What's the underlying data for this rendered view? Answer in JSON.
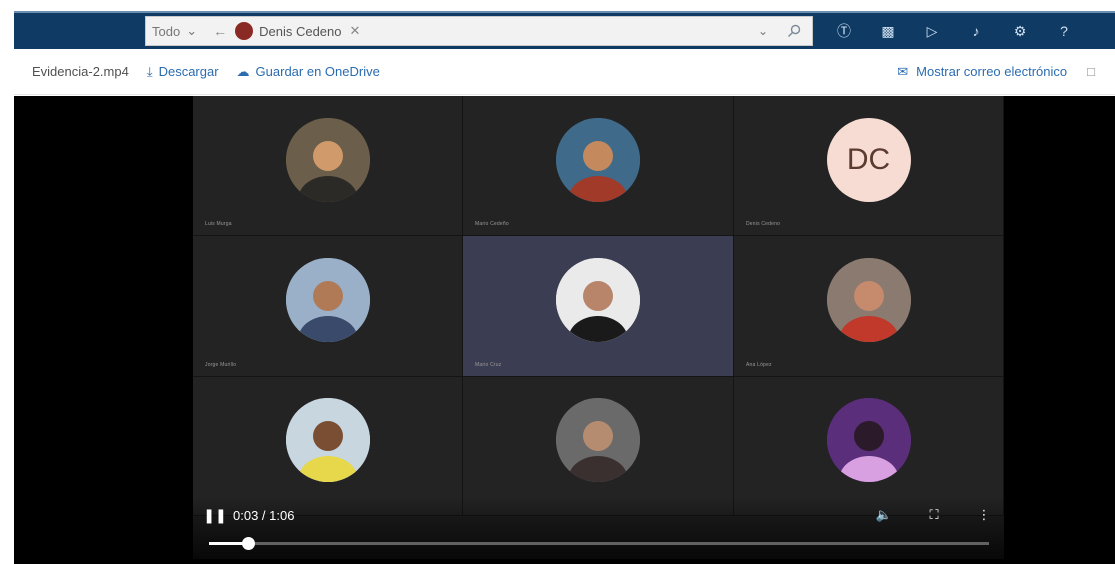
{
  "search": {
    "scope": "Todo",
    "person_chip": "Denis Cedeno"
  },
  "toolbar": {
    "file_name": "Evidencia-2.mp4",
    "download_label": "Descargar",
    "onedrive_label": "Guardar en OneDrive",
    "show_email_label": "Mostrar correo electrónico"
  },
  "participants": [
    {
      "initials": "",
      "name": "Luis Murga",
      "colors": [
        "#6b5e4a",
        "#2c2a26",
        "#d09a6a"
      ]
    },
    {
      "initials": "",
      "name": "Mario Cedeño",
      "colors": [
        "#3f6a8a",
        "#a23a2a",
        "#c48a5e"
      ]
    },
    {
      "initials": "DC",
      "name": "Denis Cedeno",
      "colors": [
        "#f6dcd2",
        "#f6dcd2",
        "#f6dcd2"
      ]
    },
    {
      "initials": "",
      "name": "Jorge Murillo",
      "colors": [
        "#9ab0c8",
        "#3a4a6a",
        "#b07a56"
      ]
    },
    {
      "initials": "",
      "name": "Mario Cruz",
      "colors": [
        "#eaeaea",
        "#1a1a1a",
        "#b8846a"
      ]
    },
    {
      "initials": "",
      "name": "Ana López",
      "colors": [
        "#8a7a70",
        "#c0392b",
        "#c58b6c"
      ]
    },
    {
      "initials": "",
      "name": "",
      "colors": [
        "#c8d6e0",
        "#e6d84a",
        "#7a4e32"
      ]
    },
    {
      "initials": "",
      "name": "",
      "colors": [
        "#6a6a6a",
        "#3a3030",
        "#b58c70"
      ]
    },
    {
      "initials": "",
      "name": "",
      "colors": [
        "#5a2e7a",
        "#d8a0e0",
        "#2a1a2a"
      ]
    }
  ],
  "player": {
    "time": "0:03 / 1:06",
    "progress_fraction": 0.05
  }
}
